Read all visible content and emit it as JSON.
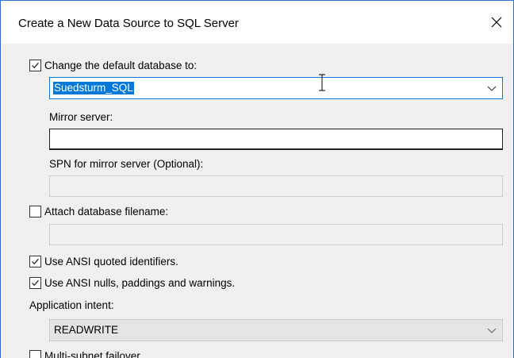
{
  "window": {
    "title": "Create a New Data Source to SQL Server"
  },
  "default_database": {
    "checkbox_label": "Change the default database to:",
    "checked": true,
    "selected_value": "Suedsturm_SQL"
  },
  "mirror_server": {
    "label": "Mirror server:",
    "value": ""
  },
  "spn_mirror": {
    "label": "SPN for mirror server (Optional):",
    "value": ""
  },
  "attach_db": {
    "checkbox_label": "Attach database filename:",
    "checked": false,
    "value": ""
  },
  "ansi_quoted": {
    "label": "Use ANSI quoted identifiers.",
    "checked": true
  },
  "ansi_nulls": {
    "label": "Use ANSI nulls, paddings and warnings.",
    "checked": true
  },
  "application_intent": {
    "label": "Application intent:",
    "selected_value": "READWRITE"
  },
  "multi_subnet": {
    "label": "Multi-subnet failover",
    "checked": false
  },
  "icons": {
    "close": "close-icon",
    "dropdown": "chevron-down-icon",
    "check": "check-icon",
    "cursor": "text-cursor-icon"
  }
}
